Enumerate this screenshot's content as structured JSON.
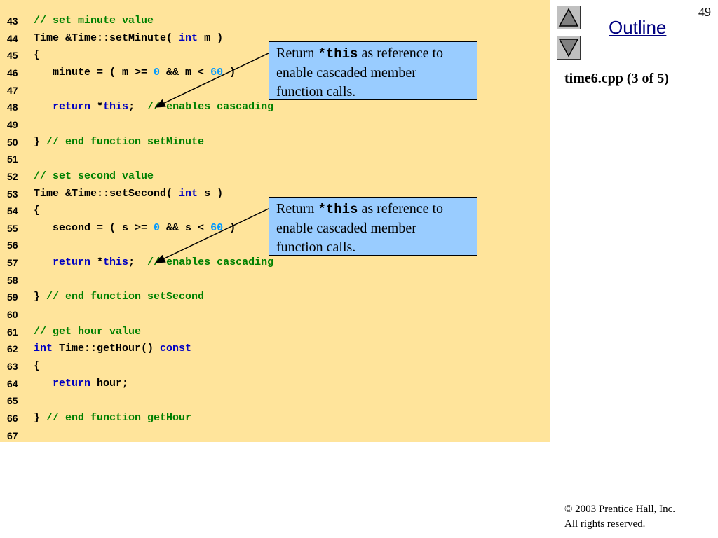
{
  "page_number": "49",
  "outline_label": "Outline",
  "file_title": "time6.cpp (3 of 5)",
  "copyright_line1": "© 2003 Prentice Hall, Inc.",
  "copyright_line2": "All rights reserved.",
  "colors": {
    "code_background": "#ffe49b",
    "callout_background": "#99ccff",
    "comment": "#008000",
    "keyword": "#0000c0",
    "number": "#0099ff",
    "link": "#000080"
  },
  "icons": {
    "up": "up-triangle-icon",
    "down": "down-triangle-icon"
  },
  "code_lines": [
    {
      "n": "43",
      "tokens": [
        {
          "c": "c",
          "t": "// set minute value"
        }
      ]
    },
    {
      "n": "44",
      "tokens": [
        {
          "c": "t",
          "t": "Time &Time::setMinute( "
        },
        {
          "c": "k",
          "t": "int"
        },
        {
          "c": "t",
          "t": " m )"
        }
      ]
    },
    {
      "n": "45",
      "tokens": [
        {
          "c": "t",
          "t": "{"
        }
      ]
    },
    {
      "n": "46",
      "tokens": [
        {
          "c": "t",
          "t": "   minute = ( m >= "
        },
        {
          "c": "n",
          "t": "0"
        },
        {
          "c": "t",
          "t": " && m < "
        },
        {
          "c": "n",
          "t": "60"
        },
        {
          "c": "t",
          "t": " )"
        }
      ]
    },
    {
      "n": "47",
      "tokens": []
    },
    {
      "n": "48",
      "tokens": [
        {
          "c": "t",
          "t": "   "
        },
        {
          "c": "k",
          "t": "return"
        },
        {
          "c": "t",
          "t": " *"
        },
        {
          "c": "k",
          "t": "this"
        },
        {
          "c": "t",
          "t": ";  "
        },
        {
          "c": "c",
          "t": "// enables cascading"
        }
      ]
    },
    {
      "n": "49",
      "tokens": []
    },
    {
      "n": "50",
      "tokens": [
        {
          "c": "t",
          "t": "} "
        },
        {
          "c": "c",
          "t": "// end function setMinute"
        }
      ]
    },
    {
      "n": "51",
      "tokens": []
    },
    {
      "n": "52",
      "tokens": [
        {
          "c": "c",
          "t": "// set second value"
        }
      ]
    },
    {
      "n": "53",
      "tokens": [
        {
          "c": "t",
          "t": "Time &Time::setSecond( "
        },
        {
          "c": "k",
          "t": "int"
        },
        {
          "c": "t",
          "t": " s )"
        }
      ]
    },
    {
      "n": "54",
      "tokens": [
        {
          "c": "t",
          "t": "{"
        }
      ]
    },
    {
      "n": "55",
      "tokens": [
        {
          "c": "t",
          "t": "   second = ( s >= "
        },
        {
          "c": "n",
          "t": "0"
        },
        {
          "c": "t",
          "t": " && s < "
        },
        {
          "c": "n",
          "t": "60"
        },
        {
          "c": "t",
          "t": " )"
        }
      ]
    },
    {
      "n": "56",
      "tokens": []
    },
    {
      "n": "57",
      "tokens": [
        {
          "c": "t",
          "t": "   "
        },
        {
          "c": "k",
          "t": "return"
        },
        {
          "c": "t",
          "t": " *"
        },
        {
          "c": "k",
          "t": "this"
        },
        {
          "c": "t",
          "t": ";  "
        },
        {
          "c": "c",
          "t": "// enables cascading"
        }
      ]
    },
    {
      "n": "58",
      "tokens": []
    },
    {
      "n": "59",
      "tokens": [
        {
          "c": "t",
          "t": "} "
        },
        {
          "c": "c",
          "t": "// end function setSecond"
        }
      ]
    },
    {
      "n": "60",
      "tokens": []
    },
    {
      "n": "61",
      "tokens": [
        {
          "c": "c",
          "t": "// get hour value"
        }
      ]
    },
    {
      "n": "62",
      "tokens": [
        {
          "c": "k",
          "t": "int"
        },
        {
          "c": "t",
          "t": " Time::getHour() "
        },
        {
          "c": "k",
          "t": "const"
        }
      ]
    },
    {
      "n": "63",
      "tokens": [
        {
          "c": "t",
          "t": "{"
        }
      ]
    },
    {
      "n": "64",
      "tokens": [
        {
          "c": "t",
          "t": "   "
        },
        {
          "c": "k",
          "t": "return"
        },
        {
          "c": "t",
          "t": " hour;"
        }
      ]
    },
    {
      "n": "65",
      "tokens": []
    },
    {
      "n": "66",
      "tokens": [
        {
          "c": "t",
          "t": "} "
        },
        {
          "c": "c",
          "t": "// end function getHour"
        }
      ]
    },
    {
      "n": "67",
      "tokens": []
    }
  ],
  "callouts": [
    {
      "pre": "Return ",
      "code": "*this",
      "post": " as reference to",
      "line2": "enable cascaded member",
      "line3": "function calls."
    },
    {
      "pre": "Return ",
      "code": "*this",
      "post": " as reference to",
      "line2": "enable cascaded member",
      "line3": "function calls."
    }
  ]
}
